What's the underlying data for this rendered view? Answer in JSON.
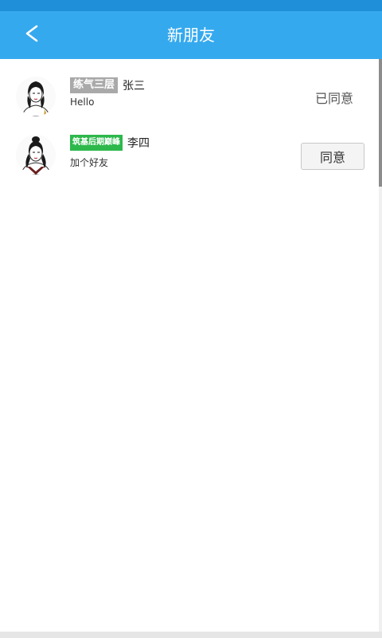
{
  "header": {
    "title": "新朋友",
    "back_icon": "back-chevron-icon"
  },
  "colors": {
    "header_bg": "#35a9ee",
    "badge_gray": "#a9a9a9",
    "badge_green": "#2db84b"
  },
  "friends": [
    {
      "badge": "练气三层",
      "badge_color": "gray",
      "name": "张三",
      "message": "Hello",
      "status": "已同意"
    },
    {
      "badge": "筑基后期巅峰",
      "badge_color": "green",
      "name": "李四",
      "message": "加个好友",
      "action": "同意"
    }
  ]
}
